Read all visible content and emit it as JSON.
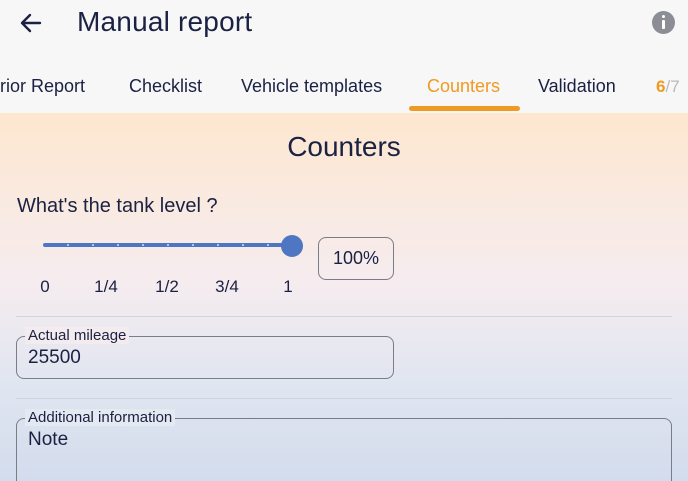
{
  "header": {
    "title": "Manual report",
    "back_icon": "arrow-left-icon",
    "info_icon": "info-icon"
  },
  "tabs": [
    {
      "label": "rior Report",
      "active": false
    },
    {
      "label": "Checklist",
      "active": false
    },
    {
      "label": "Vehicle templates",
      "active": false
    },
    {
      "label": "Counters",
      "active": true
    },
    {
      "label": "Validation",
      "active": false
    }
  ],
  "step": {
    "current": "6",
    "total": "/7"
  },
  "section": {
    "title": "Counters"
  },
  "tank": {
    "question": "What's the tank level ?",
    "value_display": "100%",
    "level_fraction": 1.0,
    "ticks": [
      "0",
      "1/4",
      "1/2",
      "3/4",
      "1"
    ]
  },
  "mileage": {
    "label": "Actual mileage",
    "value": "25500"
  },
  "additional_info": {
    "label": "Additional information",
    "placeholder": "Note"
  },
  "colors": {
    "accent": "#ef9a23",
    "slider": "#4e76c2",
    "text": "#1a2142"
  }
}
